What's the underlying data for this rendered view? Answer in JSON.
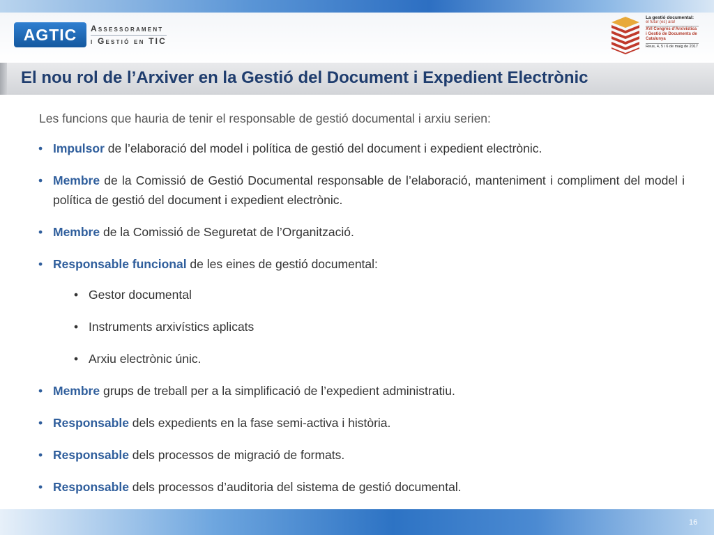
{
  "header": {
    "logo_text": "AGTIC",
    "logo_tagline_1": "Assessorament",
    "logo_tagline_2": "i Gestió en TIC",
    "congress": {
      "line1": "La gestió documental:",
      "line2": "el futur (es) ara!",
      "line3": "XVI Congrés d’Arxivística i Gestió de Documents de Catalunya",
      "line4": "Reus, 4, 5 i 6 de maig de 2017"
    }
  },
  "slide": {
    "title": "El nou rol de l’Arxiver en la Gestió del Document i Expedient Electrònic",
    "intro": "Les funcions que hauria de tenir el responsable de gestió documental i arxiu serien:",
    "items": [
      {
        "keyword": "Impulsor",
        "text": " de l’elaboració del model i política de gestió del document i expedient electrònic."
      },
      {
        "keyword": "Membre",
        "text": " de la Comissió de Gestió Documental responsable de l’elaboració, manteniment i compliment del model i política de gestió del document i expedient electrònic."
      },
      {
        "keyword": "Membre",
        "text": " de la Comissió de Seguretat de l’Organització."
      },
      {
        "keyword": "Responsable funcional",
        "text": " de les eines de gestió documental:"
      },
      {
        "keyword": "Membre",
        "text": " grups de treball per a la simplificació de l’expedient administratiu."
      },
      {
        "keyword": "Responsable",
        "text": " dels expedients en la fase semi-activa i història."
      },
      {
        "keyword": "Responsable",
        "text": " dels processos de migració de formats."
      },
      {
        "keyword": "Responsable",
        "text": " dels processos d’auditoria del sistema de gestió documental."
      }
    ],
    "subitems": [
      "Gestor documental",
      "Instruments arxivístics aplicats",
      "Arxiu electrònic únic."
    ]
  },
  "footer": {
    "page_number": "16"
  },
  "colors": {
    "title": "#1f3d6e",
    "keyword": "#2f5e9c",
    "brand": "#1d66b3"
  }
}
